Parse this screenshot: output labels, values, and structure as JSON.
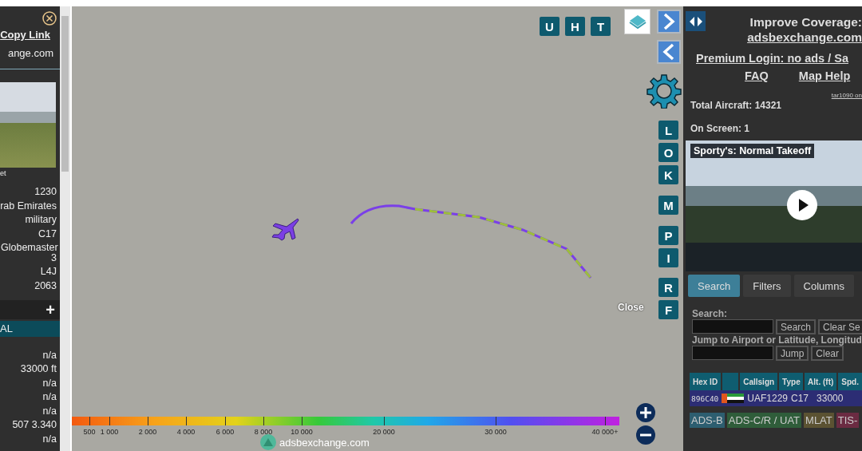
{
  "detail_panel": {
    "copy_link": "Copy Link",
    "site": "ange.com",
    "photo_caption": "et",
    "fields": [
      "1230",
      "rab Emirates",
      "military",
      "C17",
      "Globemaster 3",
      "L4J",
      "2063"
    ],
    "section_toggle": "+",
    "section_title": "AL",
    "position_fields": [
      "n/a",
      "33000 ft",
      "n/a",
      "n/a",
      "n/a",
      "507  3.340",
      "n/a"
    ]
  },
  "map": {
    "top_buttons": [
      "U",
      "H",
      "T"
    ],
    "side_buttons": [
      "L",
      "O",
      "K",
      "M",
      "P",
      "I",
      "R",
      "F"
    ],
    "close": "Close",
    "legend": [
      "500",
      "1 000",
      "2 000",
      "4 000",
      "6 000",
      "8 000",
      "10 000",
      "20 000",
      "30 000",
      "40 000+"
    ],
    "attribution": "adsbexchange.com"
  },
  "sidebar": {
    "heading": "Improve Coverage:",
    "coverage_link": "adsbexchange.com",
    "premium_link": "Premium Login: no ads / Sa",
    "links": [
      "FAQ",
      "Map Help"
    ],
    "version": "tar1090 on",
    "total_aircraft": "Total Aircraft: 14321",
    "on_screen": "On Screen: 1",
    "video_title": "Sporty's: Normal Takeoff",
    "tabs": [
      {
        "label": "Search",
        "selected": true
      },
      {
        "label": "Filters",
        "selected": false
      },
      {
        "label": "Columns",
        "selected": false
      }
    ],
    "search_label": "Search:",
    "search_buttons": [
      "Search",
      "Clear Se"
    ],
    "jump_label": "Jump to Airport or Latitude, Longitud",
    "jump_buttons": [
      "Jump",
      "Clear"
    ],
    "table": {
      "columns": [
        {
          "kind": "text",
          "label": "Hex ID"
        },
        {
          "kind": "flag"
        },
        {
          "kind": "text",
          "label": "Callsign"
        },
        {
          "kind": "text",
          "label": "Type"
        },
        {
          "kind": "text",
          "label": "Alt. (ft)"
        },
        {
          "kind": "text",
          "label": "Spd."
        }
      ],
      "rows": [
        {
          "selected": true,
          "hex": "896C40",
          "callsign": "UAF1229",
          "type": "C17",
          "altitude": "33000"
        }
      ]
    },
    "sources": [
      {
        "label": "ADS-B",
        "color": "#2d5e70"
      },
      {
        "label": "ADS-C/R / UAT",
        "color": "#2f5d3a"
      },
      {
        "label": "MLAT",
        "color": "#5b5232"
      },
      {
        "label": "TIS-",
        "color": "#6b2b42"
      }
    ]
  }
}
